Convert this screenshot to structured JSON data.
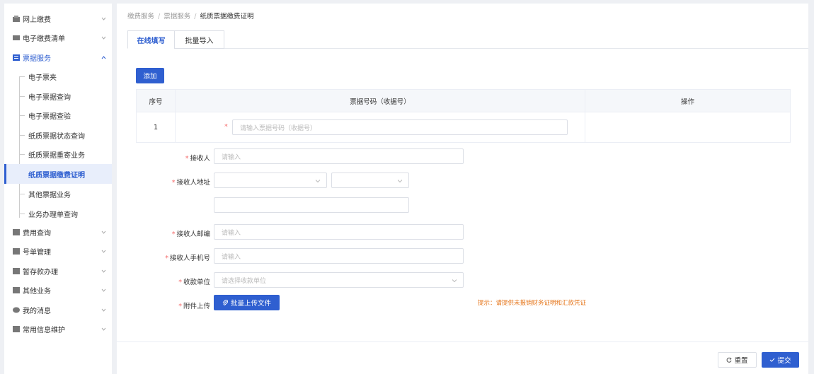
{
  "sidebar": {
    "items": [
      {
        "label": "网上缴费"
      },
      {
        "label": "电子缴费清单"
      },
      {
        "label": "票据服务"
      },
      {
        "label": "费用查询"
      },
      {
        "label": "号单管理"
      },
      {
        "label": "暂存款办理"
      },
      {
        "label": "其他业务"
      },
      {
        "label": "我的消息"
      },
      {
        "label": "常用信息维护"
      }
    ],
    "sub_items": [
      {
        "label": "电子票夹"
      },
      {
        "label": "电子票据查询"
      },
      {
        "label": "电子票据查验"
      },
      {
        "label": "纸质票据状态查询"
      },
      {
        "label": "纸质票据重寄业务"
      },
      {
        "label": "纸质票据缴费证明"
      },
      {
        "label": "其他票据业务"
      },
      {
        "label": "业务办理单查询"
      }
    ]
  },
  "breadcrumb": {
    "item1": "缴费服务",
    "item2": "票据服务",
    "current": "纸质票据缴费证明",
    "sep": "/"
  },
  "tabs": [
    {
      "label": "在线填写"
    },
    {
      "label": "批量导入"
    }
  ],
  "add_button": "添加",
  "table": {
    "headers": [
      "序号",
      "票据号码（收据号）",
      "操作"
    ],
    "rows": [
      {
        "index": "1",
        "placeholder": "请输入票据号码（收据号）"
      }
    ]
  },
  "form": {
    "required_mark": "*",
    "receiver_label": "接收人",
    "receiver_placeholder": "请输入",
    "address_label": "接收人地址",
    "postcode_label": "接收人邮编",
    "postcode_placeholder": "请输入",
    "phone_label": "接收人手机号",
    "phone_placeholder": "请输入",
    "payee_label": "收款单位",
    "payee_placeholder": "请选择收款单位",
    "attachment_label": "附件上传",
    "upload_button": "批量上传文件",
    "hint": "提示：请提供未报销财务证明和汇款凭证"
  },
  "footer": {
    "reset_button": "重置",
    "submit_button": "提交"
  },
  "colors": {
    "accent": "#2f5fd0",
    "required": "#f56c6c",
    "hint": "#e6771d"
  }
}
